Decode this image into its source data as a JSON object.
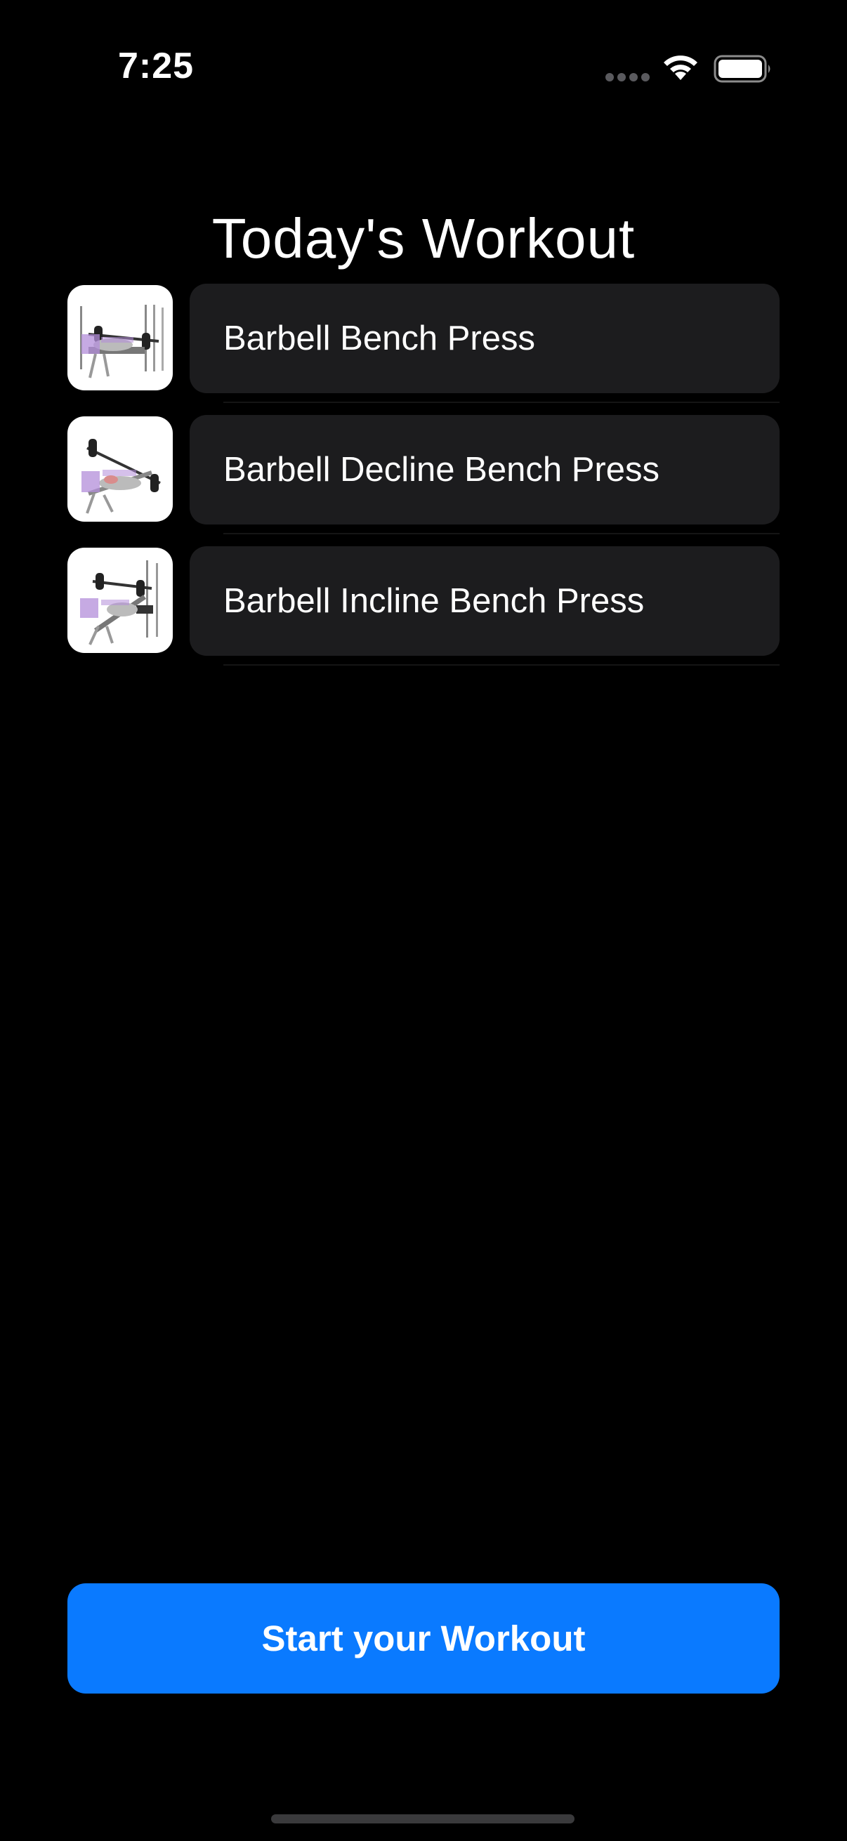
{
  "status_bar": {
    "time": "7:25",
    "icons": [
      "signal-dots-icon",
      "wifi-icon",
      "battery-icon"
    ]
  },
  "page": {
    "title": "Today's Workout"
  },
  "exercises": [
    {
      "name": "Barbell Bench Press",
      "thumbnail": "bench-press-icon"
    },
    {
      "name": "Barbell Decline Bench Press",
      "thumbnail": "decline-bench-press-icon"
    },
    {
      "name": "Barbell Incline Bench Press",
      "thumbnail": "incline-bench-press-icon"
    }
  ],
  "start_button": {
    "label": "Start your Workout"
  },
  "colors": {
    "background": "#000000",
    "card": "#1c1c1e",
    "accent": "#0a7aff",
    "text": "#ffffff"
  }
}
